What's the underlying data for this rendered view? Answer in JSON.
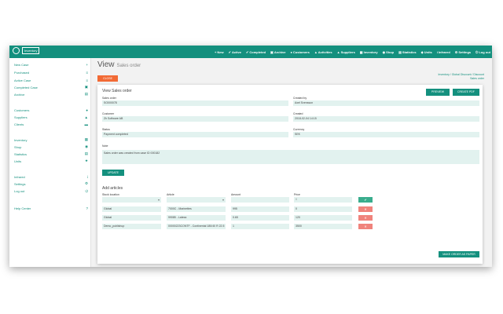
{
  "app": {
    "logo_text": "Inventory"
  },
  "nav": [
    {
      "icon": "plus-icon",
      "glyph": "+",
      "label": "New"
    },
    {
      "icon": "check-icon",
      "glyph": "✔",
      "label": "Active"
    },
    {
      "icon": "check-icon",
      "glyph": "✔",
      "label": "Completed"
    },
    {
      "icon": "archive-icon",
      "glyph": "▣",
      "label": "Archive"
    },
    {
      "icon": "user-icon",
      "glyph": "●",
      "label": "Customers"
    },
    {
      "icon": "truck-icon",
      "glyph": "▲",
      "label": "Activities"
    },
    {
      "icon": "home-icon",
      "glyph": "▲",
      "label": "Suppliers"
    },
    {
      "icon": "grid-icon",
      "glyph": "▦",
      "label": "Inventory"
    },
    {
      "icon": "pin-icon",
      "glyph": "◉",
      "label": "Shop"
    },
    {
      "icon": "chart-icon",
      "glyph": "▤",
      "label": "Statistics"
    },
    {
      "icon": "units-icon",
      "glyph": "◆",
      "label": "Units"
    },
    {
      "icon": "info-icon",
      "glyph": "i",
      "label": "Infrared"
    },
    {
      "icon": "gear-icon",
      "glyph": "⚙",
      "label": "Settings"
    },
    {
      "icon": "power-icon",
      "glyph": "⏻",
      "label": "Log out"
    }
  ],
  "sidebar": {
    "items": [
      {
        "label": "New Case",
        "icon": "plus-icon",
        "glyph": "+"
      },
      {
        "label": "Purchased",
        "icon": "list-icon",
        "glyph": "≡"
      },
      {
        "label": "Active Case",
        "icon": "list-icon",
        "glyph": "≡"
      },
      {
        "label": "Completed Case",
        "icon": "check-icon",
        "glyph": "▣"
      },
      {
        "label": "Archive",
        "icon": "archive-icon",
        "glyph": "▤"
      },
      {
        "label": "Customers",
        "icon": "user-icon",
        "glyph": "●"
      },
      {
        "label": "Suppliers",
        "icon": "home-icon",
        "glyph": "▲"
      },
      {
        "label": "Clients",
        "icon": "truck-icon",
        "glyph": "▬"
      },
      {
        "label": "Inventory",
        "icon": "grid-icon",
        "glyph": "▦"
      },
      {
        "label": "Shop",
        "icon": "pin-icon",
        "glyph": "◉"
      },
      {
        "label": "Statistics",
        "icon": "chart-icon",
        "glyph": "▤"
      },
      {
        "label": "Units",
        "icon": "star-icon",
        "glyph": "★"
      },
      {
        "label": "Infrared",
        "icon": "info-icon",
        "glyph": "i"
      },
      {
        "label": "Settings",
        "icon": "gear-icon",
        "glyph": "⚙"
      },
      {
        "label": "Log out",
        "icon": "power-icon",
        "glyph": "⏻"
      },
      {
        "label": "Help Center",
        "icon": "help-icon",
        "glyph": "?"
      }
    ]
  },
  "header": {
    "title": "View",
    "subtitle": "Sales order",
    "close_label": "CLOSE"
  },
  "breadcrumb": "Inventory / Global Discount / Discount Sales order",
  "panel": {
    "title": "View Sales order",
    "preview_label": "PREVIEW",
    "create_pdf_label": "CREATE PDF",
    "sales_order_label": "Sales order",
    "sales_order_value": "SO000078",
    "created_by_label": "Created by",
    "created_by_value": "Axel Svensson",
    "customer_label": "Customer",
    "customer_value": "Zh Software AB",
    "created_label": "Created",
    "created_value": "2018-02-04 14:15",
    "status_label": "Status",
    "status_value": "Payment completed",
    "currency_label": "Currency",
    "currency_value": "SEK",
    "note_label": "Note",
    "note_value": "Sales order was created from case ID 000182",
    "update_label": "UPDATE",
    "add_articles_title": "Add articles",
    "columns": [
      "Stock location",
      "Article",
      "Amount",
      "Price"
    ],
    "new_row": {
      "price_placeholder": "0"
    },
    "rows": [
      {
        "location": "Global",
        "article": "7000C - Marinettes",
        "amount": "995",
        "price": "0"
      },
      {
        "location": "Global",
        "article": "99085 - Latexa",
        "amount": "0.65",
        "price": "120"
      },
      {
        "location": "Demo_publishup",
        "article": "00000223CONTF - Continental 180/40 R 22.5",
        "amount": "1",
        "price": "3500"
      }
    ],
    "make_order_label": "MAKE ORDER AS PAPER"
  }
}
